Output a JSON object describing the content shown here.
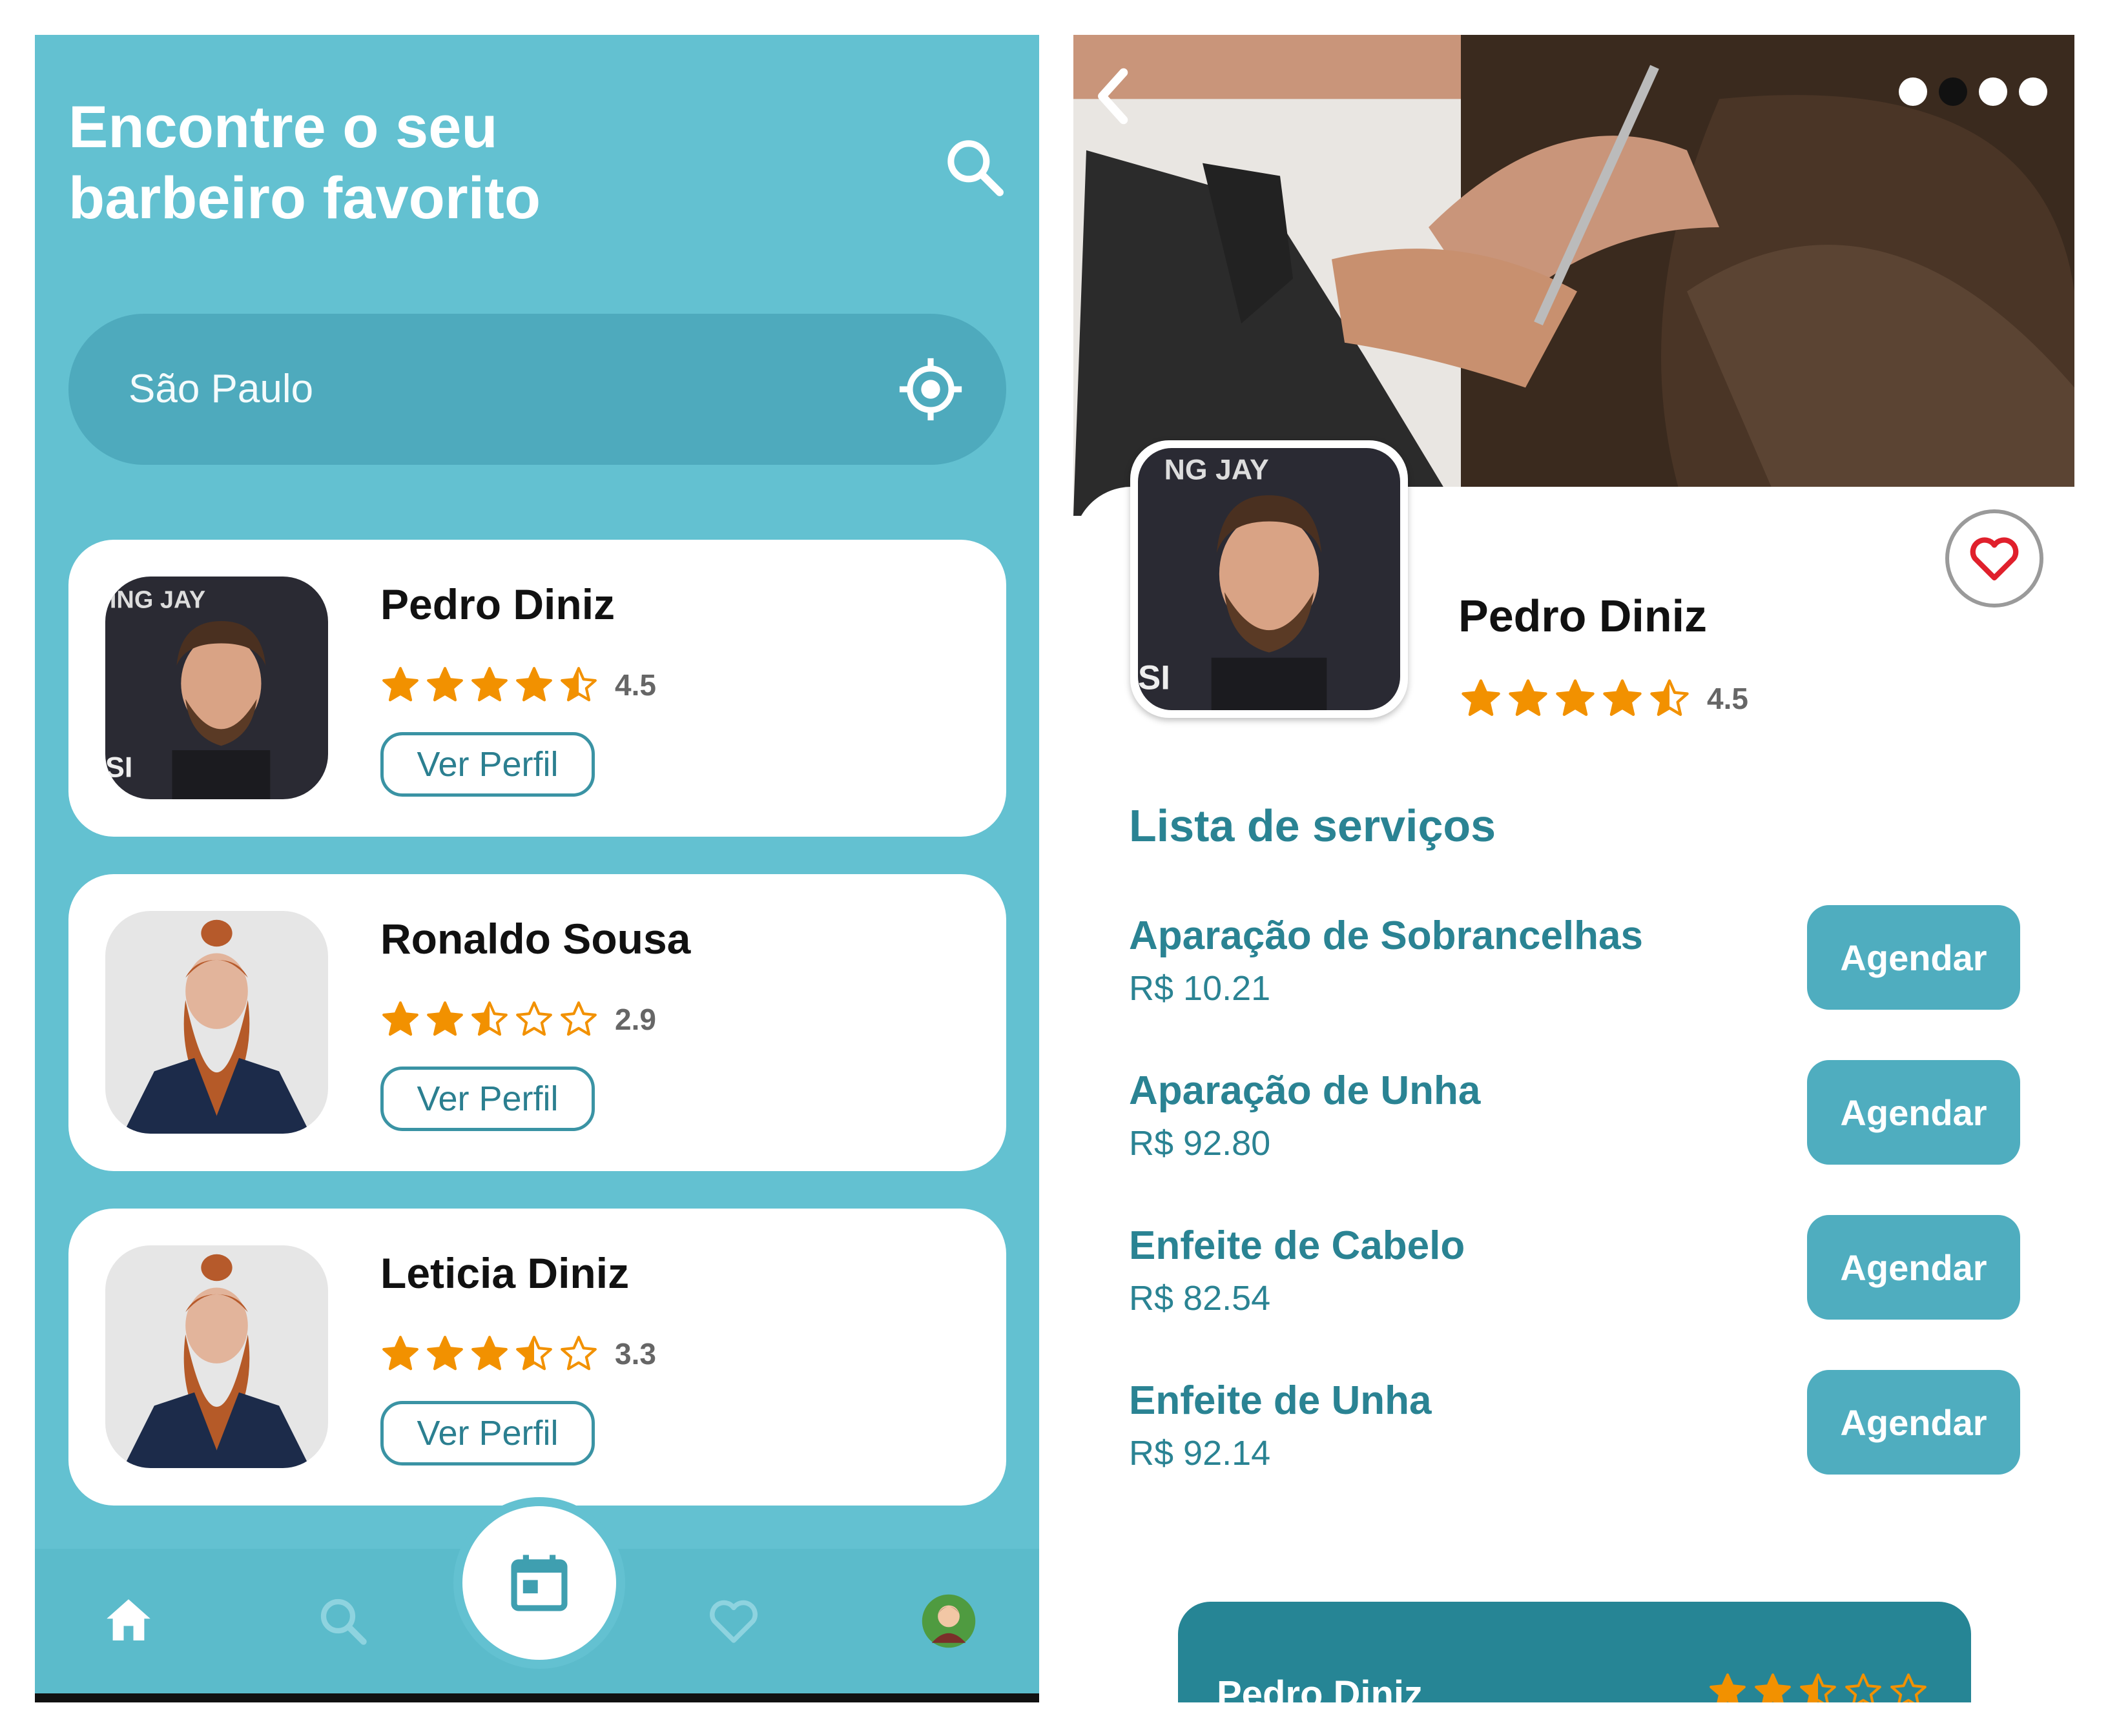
{
  "left_screen": {
    "title": "Encontre o seu\nbarbeiro favorito",
    "location": {
      "value": "São Paulo"
    },
    "barbers": [
      {
        "name": "Pedro Diniz",
        "rating": 4.5,
        "rating_label": "4.5",
        "button": "Ver Perfil"
      },
      {
        "name": "Ronaldo Sousa",
        "rating": 2.9,
        "rating_label": "2.9",
        "button": "Ver Perfil"
      },
      {
        "name": "Leticia Diniz",
        "rating": 3.3,
        "rating_label": "3.3",
        "button": "Ver Perfil"
      }
    ],
    "nav": [
      "home-icon",
      "search-icon",
      "calendar-icon",
      "heart-icon",
      "avatar"
    ]
  },
  "right_screen": {
    "barber": {
      "name": "Pedro Diniz",
      "rating": 4.5,
      "rating_label": "4.5"
    },
    "services_title": "Lista de serviços",
    "services": [
      {
        "name": "Aparação de Sobrancelhas",
        "price": "R$ 10.21",
        "button": "Agendar"
      },
      {
        "name": "Aparação de Unha",
        "price": "R$ 92.80",
        "button": "Agendar"
      },
      {
        "name": "Enfeite de Cabelo",
        "price": "R$ 82.54",
        "button": "Agendar"
      },
      {
        "name": "Enfeite de Unha",
        "price": "R$ 92.14",
        "button": "Agendar"
      }
    ],
    "bottom_card": {
      "name": "Pedro Diniz",
      "rating": 2.5
    }
  },
  "colors": {
    "primary": "#63c1d1",
    "dark_teal": "#2a8393",
    "star": "#f29100",
    "heart": "#e0202c"
  }
}
